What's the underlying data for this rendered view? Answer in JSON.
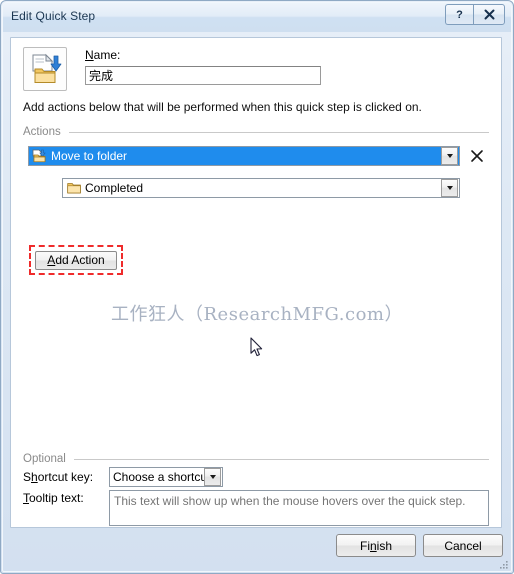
{
  "window": {
    "title": "Edit Quick Step",
    "help_button": "?",
    "close_button": "✕"
  },
  "header": {
    "icon_name": "move-to-folder-icon",
    "name_label_pre": "N",
    "name_label_post": "ame:",
    "name_value": "完成",
    "name_placeholder": ""
  },
  "instruction": "Add actions below that will be performed when this quick step is clicked on.",
  "actions": {
    "group_label": "Actions",
    "rows": [
      {
        "action_label": "Move to folder",
        "action_icon": "move-to-folder-small-icon",
        "folder_label": "Completed",
        "folder_icon": "folder-icon",
        "delete_icon": "close-x-icon"
      }
    ],
    "add_action_pre": "A",
    "add_action_post": "dd Action",
    "annotation_color": "#ef2b2b"
  },
  "watermark": "工作狂人（ResearchMFG.com）",
  "optional": {
    "group_label": "Optional",
    "shortcut_label_pre": "S",
    "shortcut_label_mid": "h",
    "shortcut_label_post": "ortcut key:",
    "shortcut_value": "Choose a shortcut",
    "tooltip_label_pre": "T",
    "tooltip_label_post": "ooltip text:",
    "tooltip_placeholder": "This text will show up when the mouse hovers over the quick step."
  },
  "footer": {
    "finish_pre": "Fi",
    "finish_mid": "n",
    "finish_post": "ish",
    "cancel_label": "Cancel"
  },
  "colors": {
    "selection_blue": "#1f8ced",
    "title_text": "#1b3651",
    "annotation_red": "#ef2b2b",
    "watermark": "#9aa5b8"
  }
}
